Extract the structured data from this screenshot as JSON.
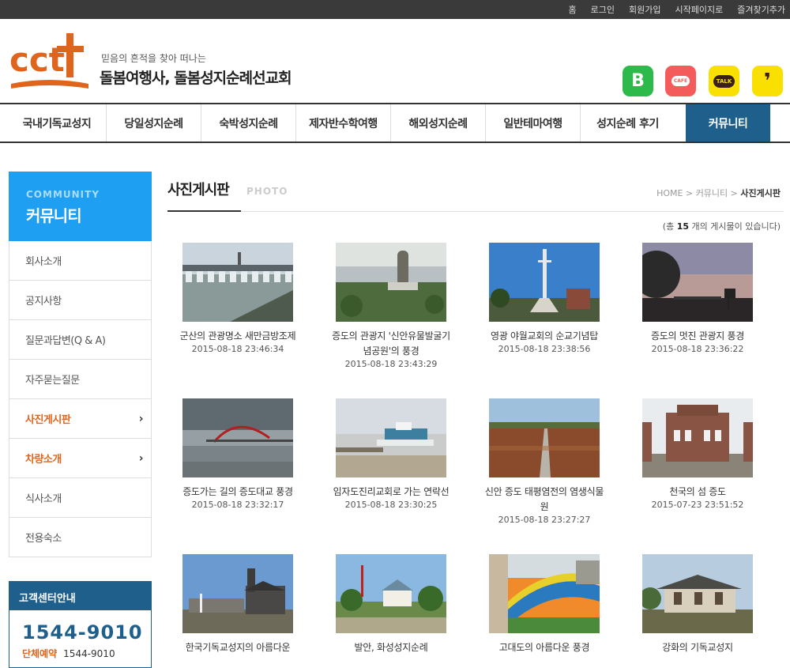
{
  "topbar": {
    "links": [
      "홈",
      "로그인",
      "회원가입",
      "시작페이지로",
      "즐겨찾기추가"
    ]
  },
  "header": {
    "logo_text": "cct",
    "tagline": "믿음의 흔적을 찾아 떠나는",
    "sitename": "돌봄여행사, 돌봄성지순례선교회",
    "sns": {
      "blog": "B",
      "cafe": "CAFE",
      "talk": "TALK",
      "story": "❜"
    }
  },
  "gnb": [
    "국내기독교성지",
    "당일성지순례",
    "숙박성지순례",
    "제자반수학여행",
    "해외성지순례",
    "일반테마여행",
    "성지순례 후기",
    "커뮤니티"
  ],
  "lnb": {
    "en": "COMMUNITY",
    "ko": "커뮤니티",
    "items": [
      {
        "label": "회사소개"
      },
      {
        "label": "공지사항"
      },
      {
        "label": "질문과답변(Q & A)"
      },
      {
        "label": "자주묻는질문"
      },
      {
        "label": "사진게시판",
        "arrow": "›"
      },
      {
        "label": "차량소개",
        "arrow": "›"
      },
      {
        "label": "식사소개"
      },
      {
        "label": "전용숙소"
      }
    ]
  },
  "cs": {
    "title": "고객센터안내",
    "phone": "1544-9010",
    "sub_label": "단체예약",
    "sub_value": "1544-9010"
  },
  "content": {
    "title": "사진게시판",
    "title_en": "PHOTO",
    "breadcrumb": {
      "home": "HOME",
      "sep": ">",
      "parent": "커뮤니티",
      "current": "사진게시판"
    },
    "count": {
      "pre": "(총",
      "num": "15",
      "post": "개의 게시물이 있습니다)"
    }
  },
  "posts": [
    {
      "title": "군산의 관광명소 새만금방조제",
      "date": "2015-08-18 23:46:34",
      "scene": "dam"
    },
    {
      "title": "증도의 관광지 '신안유물발굴기념공원'의 풍경",
      "date": "2015-08-18 23:43:29",
      "scene": "monument"
    },
    {
      "title": "영광 야월교회의 순교기념탑",
      "date": "2015-08-18 23:38:56",
      "scene": "tower"
    },
    {
      "title": "증도의 멋진 관광지 풍경",
      "date": "2015-08-18 23:36:22",
      "scene": "sunset"
    },
    {
      "title": "증도가는 길의 증도대교 풍경",
      "date": "2015-08-18 23:32:17",
      "scene": "bridge"
    },
    {
      "title": "임자도진리교회로 가는 연락선",
      "date": "2015-08-18 23:30:25",
      "scene": "ferry"
    },
    {
      "title": "신안 증도 태평염전의 염생식물원",
      "date": "2015-08-18 23:27:27",
      "scene": "saltfield"
    },
    {
      "title": "천국의 섬 증도",
      "date": "2015-07-23 23:51:52",
      "scene": "ruin"
    },
    {
      "title": "한국기독교성지의 아름다운",
      "date": "",
      "scene": "church"
    },
    {
      "title": "발안, 화성성지순례",
      "date": "",
      "scene": "village"
    },
    {
      "title": "고대도의 아름다운 풍경",
      "date": "",
      "scene": "mural"
    },
    {
      "title": "강화의 기독교성지",
      "date": "",
      "scene": "hanok"
    }
  ],
  "colors": {
    "accent": "#1f5f8b",
    "lnb_head": "#1f9ff2",
    "highlight": "#e0651c",
    "logo": "#e0651c"
  }
}
